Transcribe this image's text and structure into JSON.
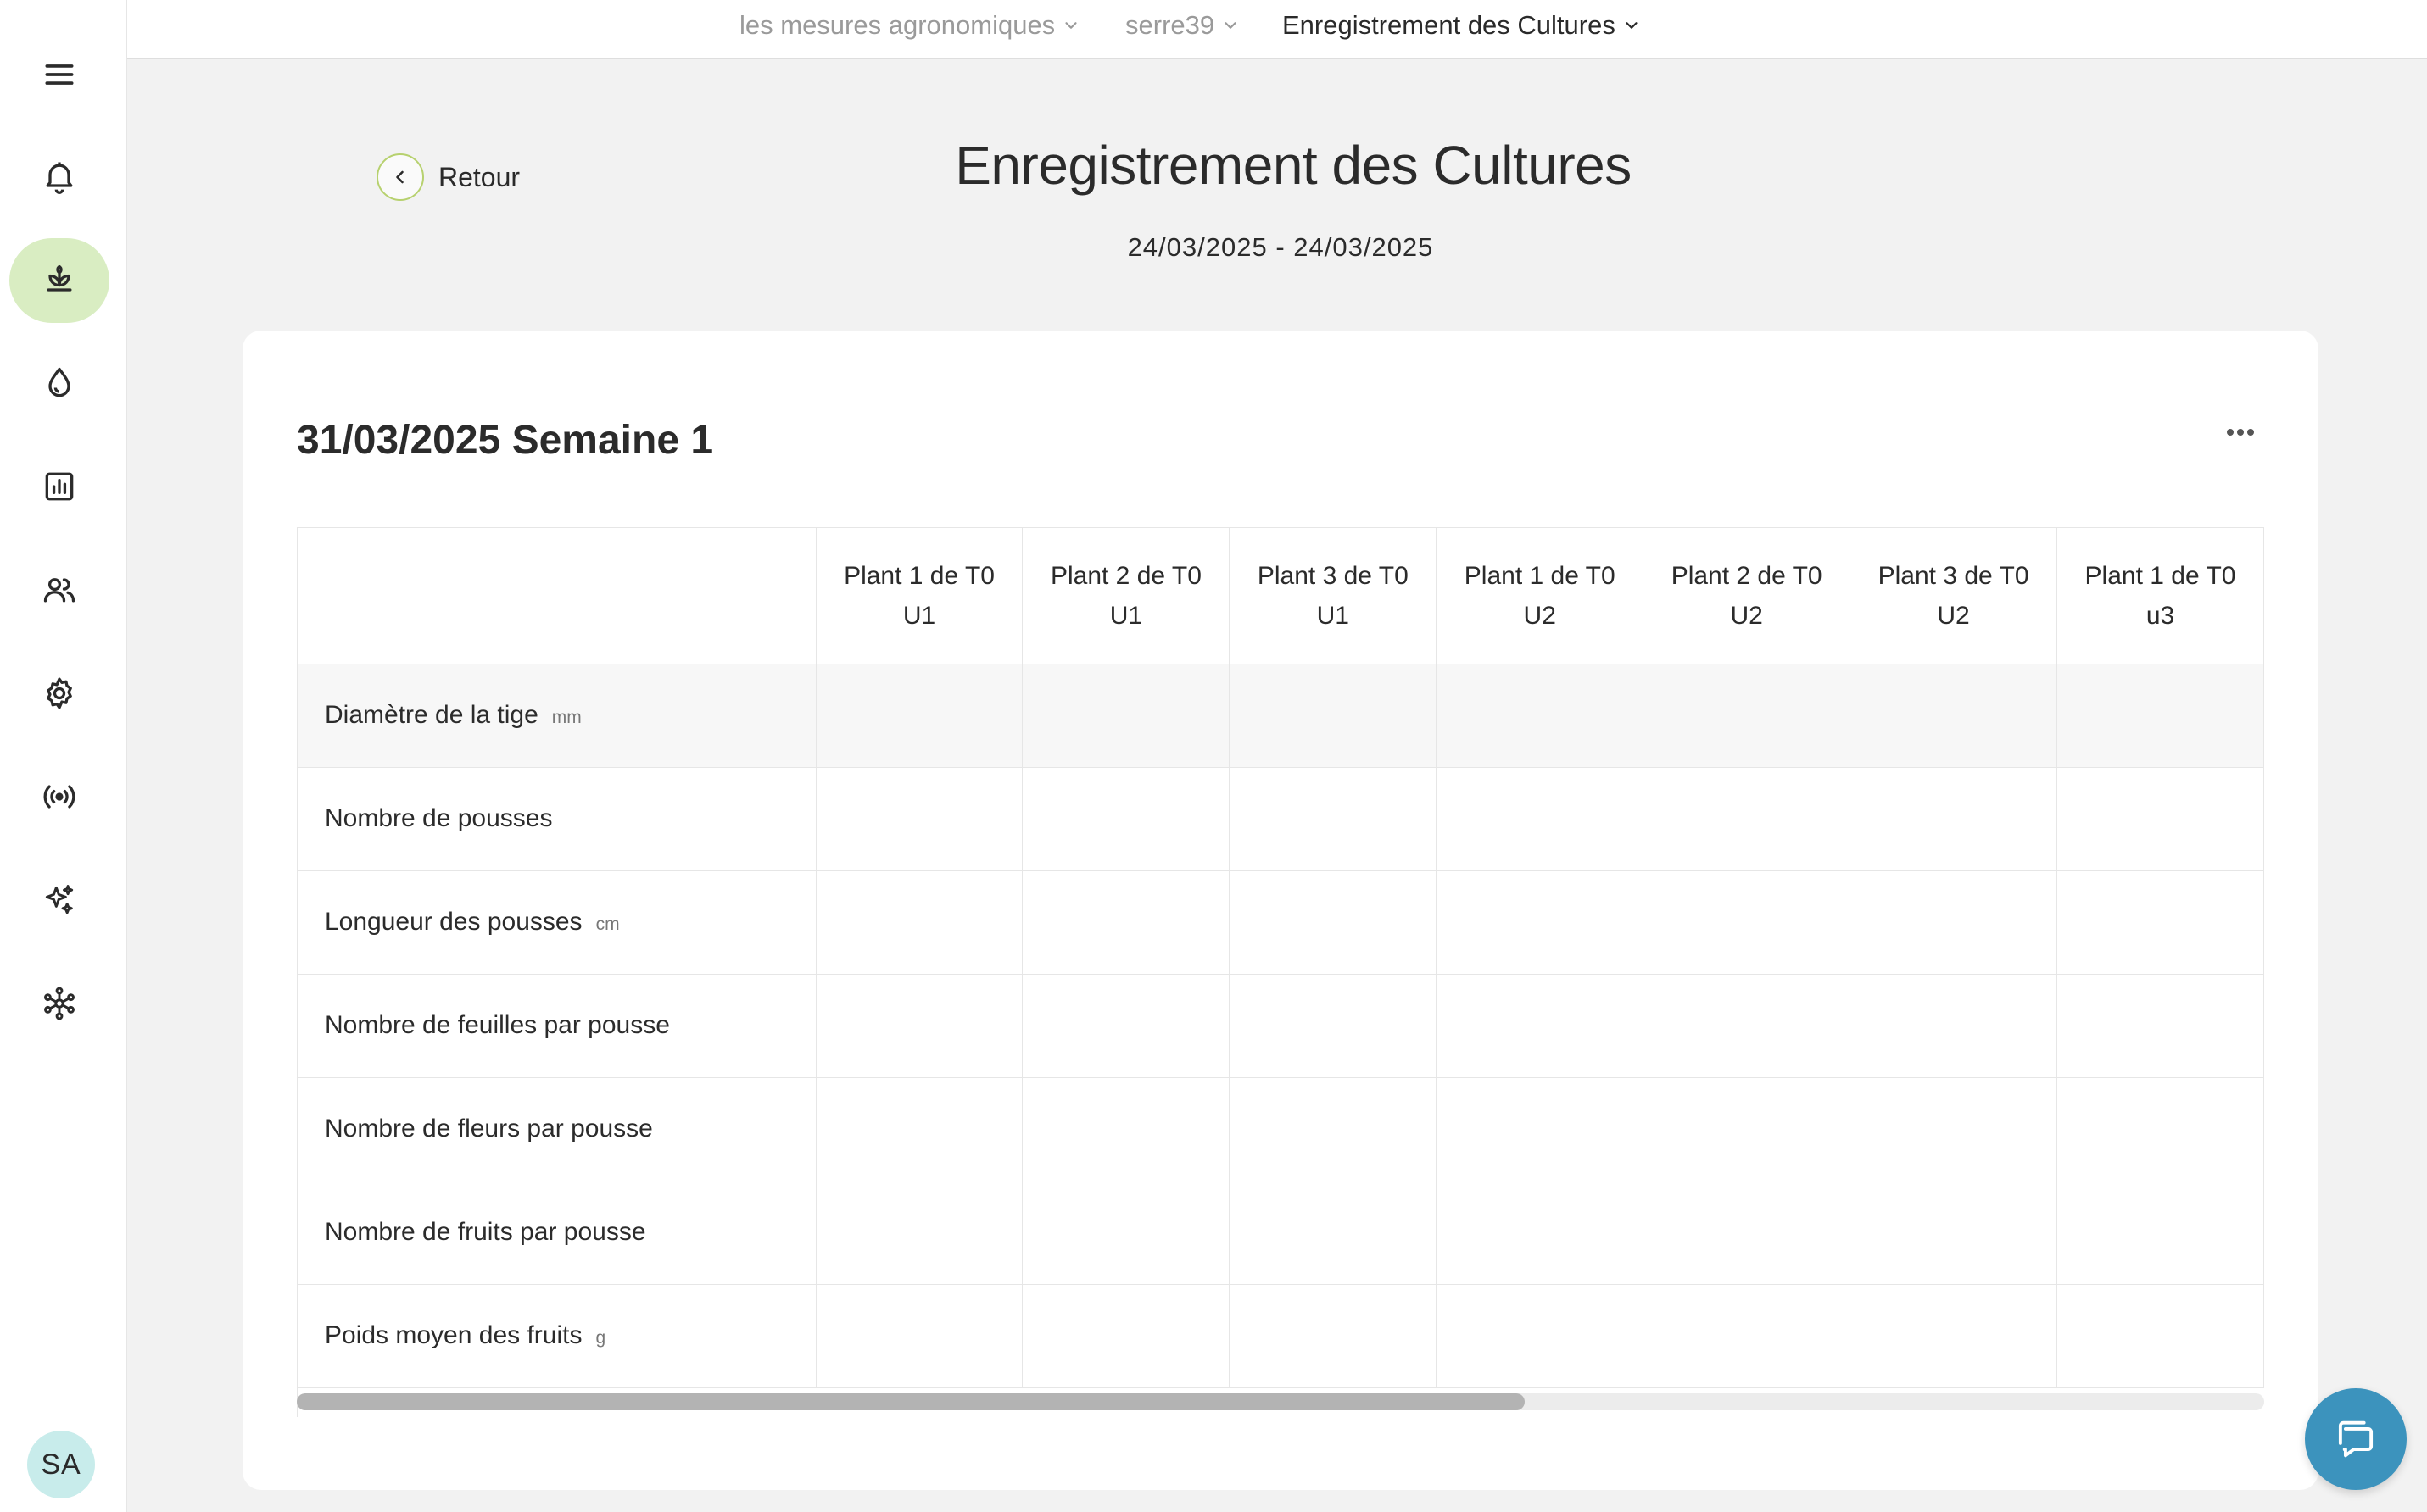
{
  "breadcrumb": [
    {
      "label": "les mesures agronomiques"
    },
    {
      "label": "serre39"
    },
    {
      "label": "Enregistrement des Cultures"
    }
  ],
  "sidebar": {
    "items": [
      {
        "icon": "menu-icon"
      },
      {
        "icon": "bell-icon"
      },
      {
        "icon": "sprout-icon",
        "active": true
      },
      {
        "icon": "water-drop-icon"
      },
      {
        "icon": "bar-chart-icon"
      },
      {
        "icon": "users-icon"
      },
      {
        "icon": "gear-icon"
      },
      {
        "icon": "broadcast-icon"
      },
      {
        "icon": "sparkles-icon"
      },
      {
        "icon": "network-icon"
      }
    ],
    "avatar_initials": "SA"
  },
  "header": {
    "back_label": "Retour",
    "title": "Enregistrement des Cultures",
    "date_range": "24/03/2025 - 24/03/2025"
  },
  "card": {
    "week_title": "31/03/2025 Semaine 1",
    "columns": [
      {
        "line1": "Plant 1 de T0",
        "line2": "U1"
      },
      {
        "line1": "Plant 2 de T0",
        "line2": "U1"
      },
      {
        "line1": "Plant 3 de T0",
        "line2": "U1"
      },
      {
        "line1": "Plant 1 de T0",
        "line2": "U2"
      },
      {
        "line1": "Plant 2 de T0",
        "line2": "U2"
      },
      {
        "line1": "Plant 3 de T0",
        "line2": "U2"
      },
      {
        "line1": "Plant 1 de T0",
        "line2": "u3"
      }
    ],
    "rows": [
      {
        "label": "Diamètre de la tige",
        "unit": "mm"
      },
      {
        "label": "Nombre de pousses",
        "unit": ""
      },
      {
        "label": "Longueur des pousses",
        "unit": "cm"
      },
      {
        "label": "Nombre de feuilles par pousse",
        "unit": ""
      },
      {
        "label": "Nombre de fleurs par pousse",
        "unit": ""
      },
      {
        "label": "Nombre de fruits par pousse",
        "unit": ""
      },
      {
        "label": "Poids moyen des fruits",
        "unit": "g"
      }
    ]
  },
  "colors": {
    "active_nav_bg": "#d9edc2",
    "back_ring": "#b7d16f",
    "chat_bubble": "#3c93bd",
    "avatar_bg": "#c8eceb"
  }
}
